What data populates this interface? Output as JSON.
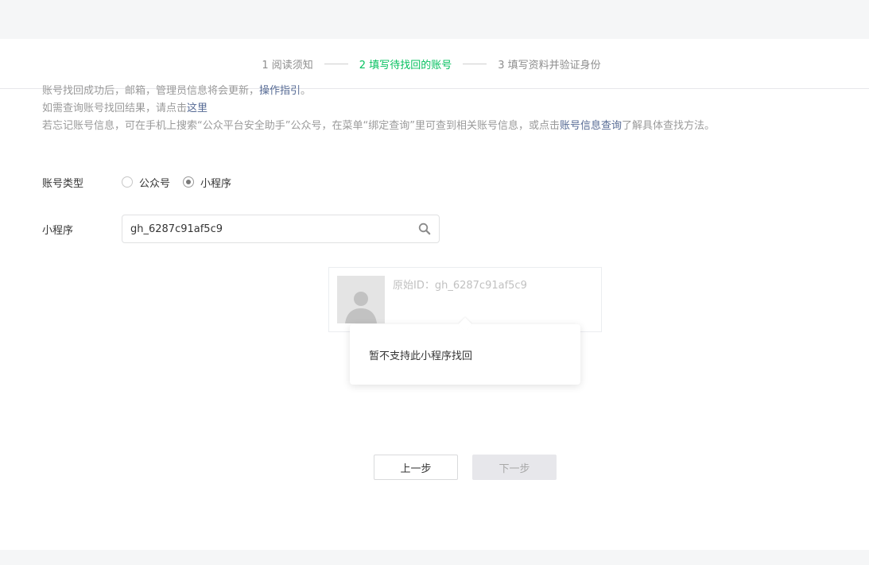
{
  "steps": [
    {
      "label": "1 阅读须知",
      "active": false
    },
    {
      "label": "2 填写待找回的账号",
      "active": true
    },
    {
      "label": "3 填写资料并验证身份",
      "active": false
    }
  ],
  "tips": {
    "line1_text": "账号找回成功后，邮箱，管理员信息将会更新，",
    "line1_link": "操作指引",
    "line1_end": "。",
    "line2_text": "如需查询账号找回结果，请点击",
    "line2_link": "这里",
    "line3_text": "若忘记账号信息，可在手机上搜索“公众平台安全助手”公众号，在菜单“绑定查询”里可查到相关账号信息，或点击",
    "line3_link": "账号信息查询",
    "line3_end": "了解具体查找方法。"
  },
  "form": {
    "type_label": "账号类型",
    "options": [
      {
        "label": "公众号",
        "checked": false
      },
      {
        "label": "小程序",
        "checked": true
      }
    ],
    "mp_label": "小程序",
    "mp_value": "gh_6287c91af5c9",
    "search_icon": "search-icon"
  },
  "result": {
    "avatar_icon": "user-avatar-icon",
    "original_id": "原始ID：gh_6287c91af5c9"
  },
  "popover": {
    "message": "暂不支持此小程序找回"
  },
  "buttons": {
    "prev": "上一步",
    "next": "下一步"
  },
  "colors": {
    "accent": "#07c160",
    "link": "#576b95"
  }
}
